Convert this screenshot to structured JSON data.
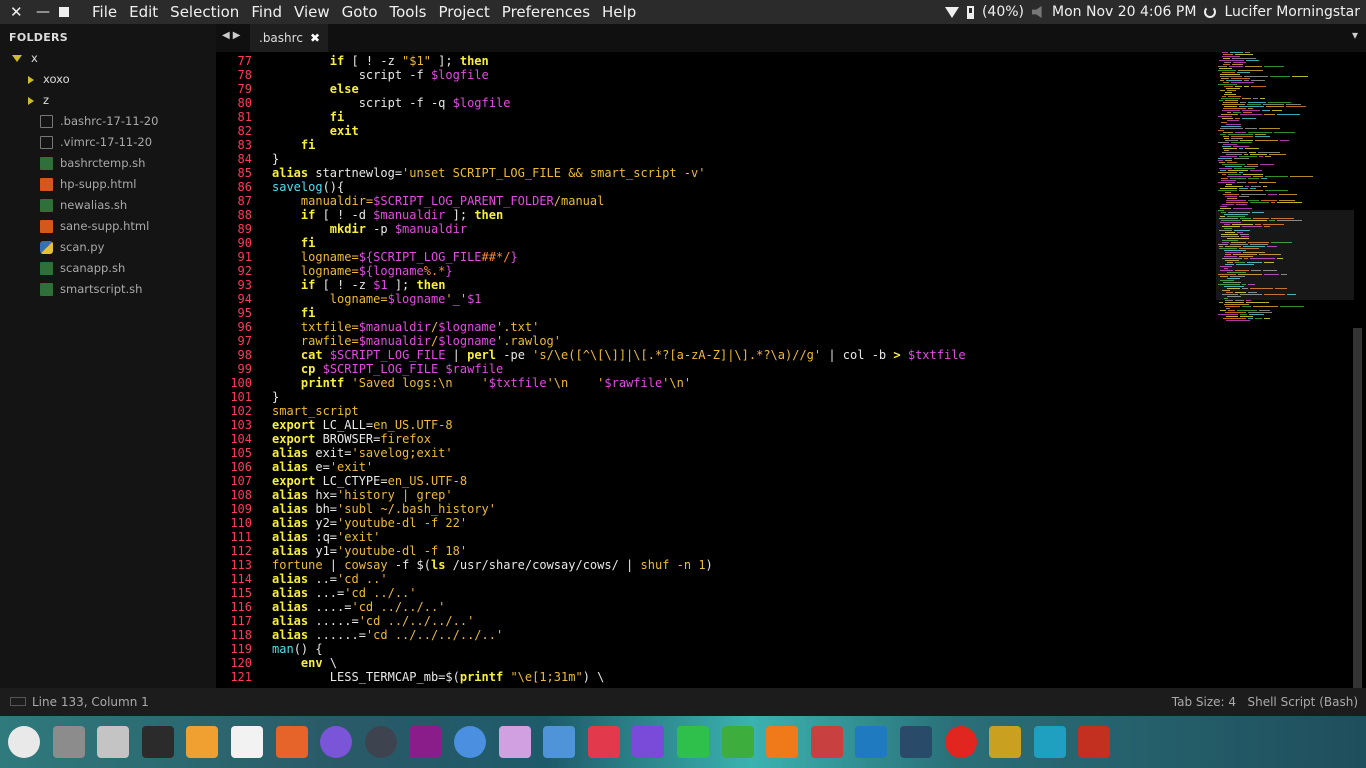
{
  "menubar": {
    "items": [
      "File",
      "Edit",
      "Selection",
      "Find",
      "View",
      "Goto",
      "Tools",
      "Project",
      "Preferences",
      "Help"
    ],
    "battery": "(40%)",
    "datetime": "Mon Nov 20  4:06 PM",
    "user": "Lucifer Morningstar"
  },
  "sidebar": {
    "title": "FOLDERS",
    "root": "x",
    "folders": [
      "xoxo",
      "z"
    ],
    "files": [
      {
        "name": ".bashrc-17-11-20",
        "icon": "file-plain-icon"
      },
      {
        "name": ".vimrc-17-11-20",
        "icon": "file-plain-icon"
      },
      {
        "name": "bashrctemp.sh",
        "icon": "shell-file-icon"
      },
      {
        "name": "hp-supp.html",
        "icon": "html5-file-icon"
      },
      {
        "name": "newalias.sh",
        "icon": "shell-file-icon"
      },
      {
        "name": "sane-supp.html",
        "icon": "html5-file-icon"
      },
      {
        "name": "scan.py",
        "icon": "python-file-icon"
      },
      {
        "name": "scanapp.sh",
        "icon": "shell-file-icon"
      },
      {
        "name": "smartscript.sh",
        "icon": "shell-file-icon"
      }
    ]
  },
  "tabs": [
    {
      "label": ".bashrc",
      "active": true
    }
  ],
  "editor": {
    "first_line": 77,
    "lines": [
      [
        [
          "        ",
          ""
        ],
        [
          "if",
          "k"
        ],
        [
          " [ ! -z ",
          ""
        ],
        [
          "\"$1\"",
          "s"
        ],
        [
          " ]; ",
          ""
        ],
        [
          "then",
          "k"
        ]
      ],
      [
        [
          "            script -f ",
          ""
        ],
        [
          "$logfile",
          "v"
        ]
      ],
      [
        [
          "        ",
          ""
        ],
        [
          "else",
          "k"
        ]
      ],
      [
        [
          "            script -f -q ",
          ""
        ],
        [
          "$logfile",
          "v"
        ]
      ],
      [
        [
          "        ",
          ""
        ],
        [
          "fi",
          "k"
        ]
      ],
      [
        [
          "        ",
          ""
        ],
        [
          "exit",
          "k"
        ]
      ],
      [
        [
          "    ",
          ""
        ],
        [
          "fi",
          "k"
        ]
      ],
      [
        [
          "}",
          ""
        ]
      ],
      [
        [
          "alias",
          "k"
        ],
        [
          " startnewlog=",
          ""
        ],
        [
          "'unset SCRIPT_LOG_FILE && smart_script -v'",
          "s"
        ]
      ],
      [
        [
          "savelog",
          "f"
        ],
        [
          "(){",
          ""
        ]
      ],
      [
        [
          "    ",
          ""
        ],
        [
          "manualdir=",
          "s"
        ],
        [
          "$SCRIPT_LOG_PARENT_FOLDER",
          "v"
        ],
        [
          "/manual",
          "s"
        ]
      ],
      [
        [
          "    ",
          ""
        ],
        [
          "if",
          "k"
        ],
        [
          " [ ! -d ",
          ""
        ],
        [
          "$manualdir",
          "v"
        ],
        [
          " ]; ",
          ""
        ],
        [
          "then",
          "k"
        ]
      ],
      [
        [
          "        ",
          ""
        ],
        [
          "mkdir",
          "k"
        ],
        [
          " -p ",
          ""
        ],
        [
          "$manualdir",
          "v"
        ]
      ],
      [
        [
          "    ",
          ""
        ],
        [
          "fi",
          "k"
        ]
      ],
      [
        [
          "    ",
          ""
        ],
        [
          "logname=",
          "s"
        ],
        [
          "${SCRIPT_LOG_FILE",
          "v"
        ],
        [
          "##*/",
          "p"
        ],
        [
          "}",
          "v"
        ]
      ],
      [
        [
          "    ",
          ""
        ],
        [
          "logname=",
          "s"
        ],
        [
          "${logname",
          "v"
        ],
        [
          "%.*",
          "p"
        ],
        [
          "}",
          "v"
        ]
      ],
      [
        [
          "    ",
          ""
        ],
        [
          "if",
          "k"
        ],
        [
          " [ ! -z ",
          ""
        ],
        [
          "$1",
          "v"
        ],
        [
          " ]; ",
          ""
        ],
        [
          "then",
          "k"
        ]
      ],
      [
        [
          "        ",
          ""
        ],
        [
          "logname=",
          "s"
        ],
        [
          "$logname",
          "v"
        ],
        [
          "'_'",
          "s"
        ],
        [
          "$1",
          "v"
        ]
      ],
      [
        [
          "    ",
          ""
        ],
        [
          "fi",
          "k"
        ]
      ],
      [
        [
          "    ",
          ""
        ],
        [
          "txtfile=",
          "s"
        ],
        [
          "$manualdir",
          "v"
        ],
        [
          "/",
          "s"
        ],
        [
          "$logname",
          "v"
        ],
        [
          "'.txt'",
          "s"
        ]
      ],
      [
        [
          "    ",
          ""
        ],
        [
          "rawfile=",
          "s"
        ],
        [
          "$manualdir",
          "v"
        ],
        [
          "/",
          "s"
        ],
        [
          "$logname",
          "v"
        ],
        [
          "'.rawlog'",
          "s"
        ]
      ],
      [
        [
          "    ",
          ""
        ],
        [
          "cat",
          "k"
        ],
        [
          " ",
          ""
        ],
        [
          "$SCRIPT_LOG_FILE",
          "v"
        ],
        [
          " | ",
          ""
        ],
        [
          "perl",
          "k"
        ],
        [
          " -pe ",
          ""
        ],
        [
          "'s/\\e([^\\[\\]]|\\[.*?[a-zA-Z]|\\].*?\\a)//g'",
          "s"
        ],
        [
          " | col -b ",
          ""
        ],
        [
          ">",
          "k"
        ],
        [
          " ",
          ""
        ],
        [
          "$txtfile",
          "v"
        ]
      ],
      [
        [
          "    ",
          ""
        ],
        [
          "cp",
          "k"
        ],
        [
          " ",
          ""
        ],
        [
          "$SCRIPT_LOG_FILE",
          "v"
        ],
        [
          " ",
          ""
        ],
        [
          "$rawfile",
          "v"
        ]
      ],
      [
        [
          "    ",
          ""
        ],
        [
          "printf",
          "k"
        ],
        [
          " ",
          ""
        ],
        [
          "'Saved logs:\\n    '",
          "s"
        ],
        [
          "$txtfile",
          "v"
        ],
        [
          "'\\n    '",
          "s"
        ],
        [
          "$rawfile",
          "v"
        ],
        [
          "'\\n'",
          "s"
        ]
      ],
      [
        [
          "}",
          ""
        ]
      ],
      [
        [
          "smart_script",
          "s"
        ]
      ],
      [
        [
          "export",
          "k"
        ],
        [
          " LC_ALL=",
          ""
        ],
        [
          "en_US.UTF-8",
          "s"
        ]
      ],
      [
        [
          "export",
          "k"
        ],
        [
          " BROWSER=",
          ""
        ],
        [
          "firefox",
          "s"
        ]
      ],
      [
        [
          "alias",
          "k"
        ],
        [
          " exit=",
          ""
        ],
        [
          "'savelog;exit'",
          "s"
        ]
      ],
      [
        [
          "alias",
          "k"
        ],
        [
          " e=",
          ""
        ],
        [
          "'exit'",
          "s"
        ]
      ],
      [
        [
          "export",
          "k"
        ],
        [
          " LC_CTYPE=",
          ""
        ],
        [
          "en_US.UTF-8",
          "s"
        ]
      ],
      [
        [
          "alias",
          "k"
        ],
        [
          " hx=",
          ""
        ],
        [
          "'history | grep'",
          "s"
        ]
      ],
      [
        [
          "alias",
          "k"
        ],
        [
          " bh=",
          ""
        ],
        [
          "'subl ~/.bash_history'",
          "s"
        ]
      ],
      [
        [
          "alias",
          "k"
        ],
        [
          " y2=",
          ""
        ],
        [
          "'youtube-dl -f 22'",
          "s"
        ]
      ],
      [
        [
          "alias",
          "k"
        ],
        [
          " :q=",
          ""
        ],
        [
          "'exit'",
          "s"
        ]
      ],
      [
        [
          "alias",
          "k"
        ],
        [
          " y1=",
          ""
        ],
        [
          "'youtube-dl -f 18'",
          "s"
        ]
      ],
      [
        [
          "fortune",
          "s"
        ],
        [
          " | ",
          ""
        ],
        [
          "cowsay",
          "s"
        ],
        [
          " -f $(",
          ""
        ],
        [
          "ls",
          "k"
        ],
        [
          " /usr/share/cowsay/cows/ | ",
          ""
        ],
        [
          "shuf -n 1",
          "s"
        ],
        [
          ")",
          ""
        ]
      ],
      [
        [
          "alias",
          "k"
        ],
        [
          " ..=",
          ""
        ],
        [
          "'cd ..'",
          "s"
        ]
      ],
      [
        [
          "alias",
          "k"
        ],
        [
          " ...=",
          ""
        ],
        [
          "'cd ../..'",
          "s"
        ]
      ],
      [
        [
          "alias",
          "k"
        ],
        [
          " ....=",
          ""
        ],
        [
          "'cd ../../..'",
          "s"
        ]
      ],
      [
        [
          "alias",
          "k"
        ],
        [
          " .....=",
          ""
        ],
        [
          "'cd ../../../..'",
          "s"
        ]
      ],
      [
        [
          "alias",
          "k"
        ],
        [
          " ......=",
          ""
        ],
        [
          "'cd ../../../../..'",
          "s"
        ]
      ],
      [
        [
          "man",
          "f"
        ],
        [
          "() {",
          ""
        ]
      ],
      [
        [
          "    ",
          ""
        ],
        [
          "env",
          "k"
        ],
        [
          " \\",
          ""
        ]
      ],
      [
        [
          "        ",
          ""
        ],
        [
          "LESS_TERMCAP_mb=$(",
          ""
        ],
        [
          "printf",
          "k"
        ],
        [
          " ",
          ""
        ],
        [
          "\"\\e[1;31m\"",
          "s"
        ],
        [
          ") \\",
          ""
        ]
      ]
    ]
  },
  "statusbar": {
    "position": "Line 133, Column 1",
    "tab_size": "Tab Size: 4",
    "syntax": "Shell Script (Bash)"
  },
  "dock": {
    "icons": [
      "ubuntu-icon",
      "downloads-folder-icon",
      "file-manager-icon",
      "terminal-icon",
      "sublime-text-icon",
      "text-editor-icon",
      "firefox-icon",
      "firefox-dev-icon",
      "gimp-icon",
      "ubuntu-tweak-icon",
      "chrome-icon",
      "app-icon",
      "cursor-icon",
      "settings-icon",
      "media-player-icon",
      "sync-icon",
      "network-icon",
      "vlc-icon",
      "app-grid-icon",
      "search-icon",
      "system-monitor-icon",
      "opera-icon",
      "gnome-icon",
      "desktop-icon",
      "trash-icon"
    ]
  },
  "colors": {
    "keyword": "#f9ee3a",
    "variable": "#e44ae4",
    "string": "#f0b93a",
    "line_number": "#ff3a5a",
    "function": "#4fe0ef"
  }
}
